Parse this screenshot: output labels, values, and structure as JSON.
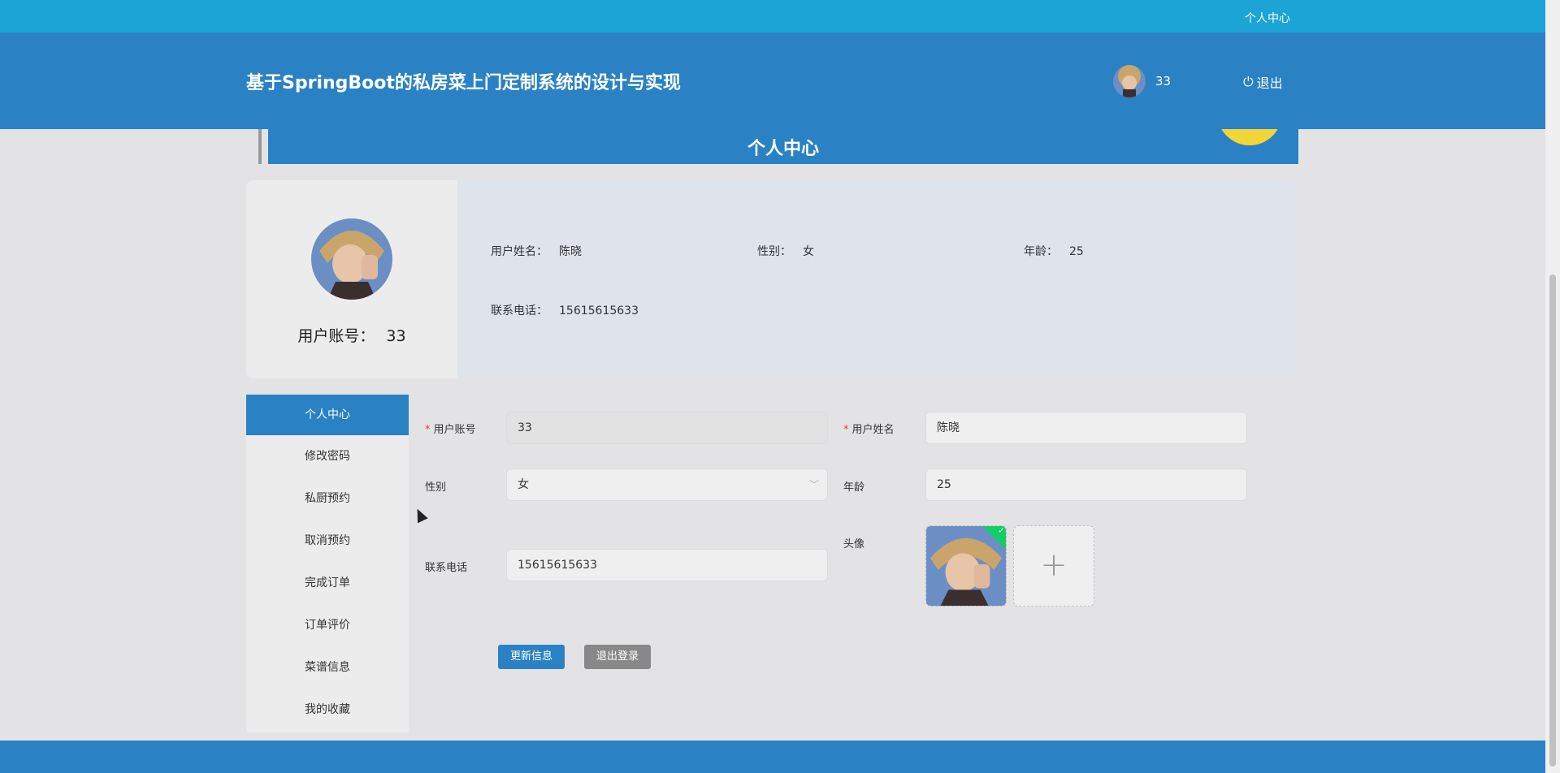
{
  "topbar": {
    "link_label": "个人中心"
  },
  "header": {
    "title": "基于SpringBoot的私房菜上门定制系统的设计与实现",
    "username": "33",
    "logout_label": "退出"
  },
  "banner": {
    "title": "个人中心"
  },
  "profile": {
    "account_label": "用户账号：",
    "account_value": "33",
    "name_label": "用户姓名：",
    "name_value": "陈晓",
    "gender_label": "性别：",
    "gender_value": "女",
    "age_label": "年龄：",
    "age_value": "25",
    "phone_label": "联系电话：",
    "phone_value": "15615615633"
  },
  "sidemenu": {
    "items": [
      {
        "label": "个人中心"
      },
      {
        "label": "修改密码"
      },
      {
        "label": "私厨预约"
      },
      {
        "label": "取消预约"
      },
      {
        "label": "完成订单"
      },
      {
        "label": "订单评价"
      },
      {
        "label": "菜谱信息"
      },
      {
        "label": "我的收藏"
      }
    ]
  },
  "form": {
    "account_label": "用户账号",
    "account_value": "33",
    "name_label": "用户姓名",
    "name_value": "陈晓",
    "gender_label": "性别",
    "gender_value": "女",
    "age_label": "年龄",
    "age_value": "25",
    "phone_label": "联系电话",
    "phone_value": "15615615633",
    "avatar_label": "头像",
    "update_button": "更新信息",
    "logout_button": "退出登录"
  },
  "colors": {
    "primary": "#2a81c3",
    "topstrip": "#1ca4d6",
    "accent_yellow": "#f2d637"
  }
}
